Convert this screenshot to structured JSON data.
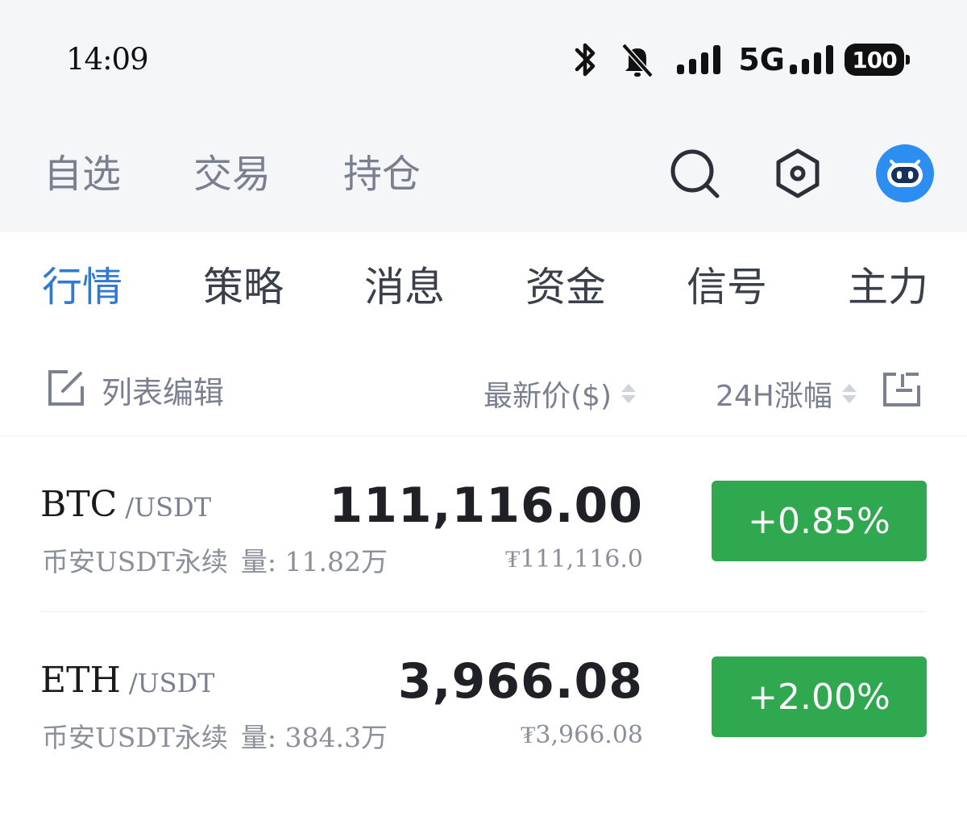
{
  "status_bar": {
    "time": "14:09",
    "network": "5G",
    "battery": "100"
  },
  "main_nav": {
    "tabs": [
      {
        "label": "自选"
      },
      {
        "label": "交易"
      },
      {
        "label": "持仓"
      }
    ],
    "icons": [
      "search-icon",
      "settings-hex-icon",
      "robot-avatar-icon"
    ]
  },
  "sub_tabs": [
    {
      "label": "行情",
      "active": true
    },
    {
      "label": "策略"
    },
    {
      "label": "消息"
    },
    {
      "label": "资金"
    },
    {
      "label": "信号"
    },
    {
      "label": "主力"
    }
  ],
  "list_header": {
    "edit_label": "列表编辑",
    "price_col": "最新价($)",
    "change_col": "24H涨幅"
  },
  "rows": [
    {
      "symbol": "BTC",
      "quote": "/USDT",
      "exchange": "币安USDT永续",
      "volume": "量: 11.82万",
      "price": "111,116.00",
      "price_cny": "₮111,116.0",
      "change": "+0.85%"
    },
    {
      "symbol": "ETH",
      "quote": "/USDT",
      "exchange": "币安USDT永续",
      "volume": "量: 384.3万",
      "price": "3,966.08",
      "price_cny": "₮3,966.08",
      "change": "+2.00%"
    }
  ],
  "colors": {
    "accent": "#2f7ad3",
    "up": "#2fa84f",
    "header_bg": "#f5f6f8"
  }
}
